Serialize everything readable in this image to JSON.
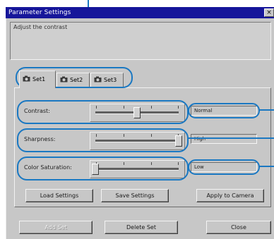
{
  "window": {
    "title": "Parameter Settings",
    "close_glyph": "×"
  },
  "description": {
    "text": "Adjust the contrast"
  },
  "tabs": [
    {
      "label": "Set1",
      "icon": "camera-icon",
      "active": true
    },
    {
      "label": "Set2",
      "icon": "camera-icon",
      "active": false
    },
    {
      "label": "Set3",
      "icon": "camera-icon",
      "active": false
    }
  ],
  "sliders": [
    {
      "label": "Contrast:",
      "value_text": "Normal",
      "level": 0.5
    },
    {
      "label": "Sharpness:",
      "value_text": "High",
      "level": 1.0
    },
    {
      "label": "Color Saturation:",
      "value_text": "Low",
      "level": 0.0
    }
  ],
  "panel_buttons": {
    "load": "Load Settings",
    "save": "Save Settings",
    "apply": "Apply to Camera"
  },
  "footer_buttons": {
    "add": "Add Set",
    "delete": "Delete Set",
    "close": "Close"
  },
  "colors": {
    "titlebar": "#16169a",
    "callout": "#1a78c2",
    "dialog_face": "#c7c7c7"
  }
}
